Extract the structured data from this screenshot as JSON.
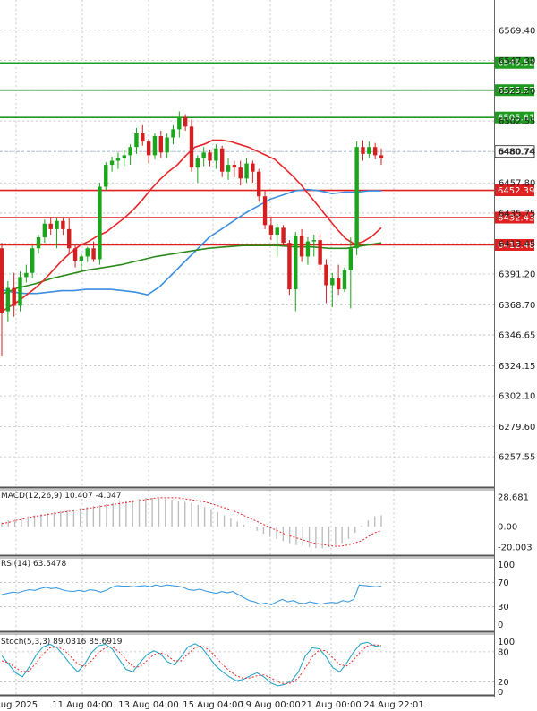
{
  "chart_data": {
    "type": "candlestick",
    "main": {
      "ylim": [
        6235.4,
        6591.5
      ],
      "y_ticks": [
        6569.4,
        6547.3,
        6525.2,
        6503.1,
        6480.74,
        6457.8,
        6435.75,
        6413.45,
        6391.2,
        6368.7,
        6346.65,
        6324.15,
        6302.1,
        6279.6,
        6257.55
      ],
      "y_tick_labels": [
        "6569.40",
        "6547.30",
        "6525.20",
        "6502.55",
        "6480.74",
        "6457.80",
        "6435.75",
        "6413.45",
        "6391.20",
        "6368.70",
        "6346.65",
        "6324.15",
        "6302.10",
        "6279.60",
        "6257.55"
      ],
      "current_price": 6480.74,
      "resistance_levels": [
        {
          "value": 6545.52,
          "label": "6545.52",
          "color": "#1e9a1e"
        },
        {
          "value": 6525.57,
          "label": "6525.57",
          "color": "#1e9a1e"
        },
        {
          "value": 6505.61,
          "label": "6505.61",
          "color": "#1e9a1e"
        }
      ],
      "support_levels": [
        {
          "value": 6452.39,
          "label": "6452.39",
          "color": "#e02020"
        },
        {
          "value": 6432.43,
          "label": "6432.43",
          "color": "#e02020"
        },
        {
          "value": 6412.48,
          "label": "6412.48",
          "color": "#e02020"
        }
      ],
      "candles": [
        [
          6410,
          6414,
          6331,
          6363
        ],
        [
          6364,
          6386,
          6356,
          6381
        ],
        [
          6381,
          6392,
          6360,
          6368
        ],
        [
          6368,
          6393,
          6364,
          6389
        ],
        [
          6389,
          6398,
          6385,
          6392
        ],
        [
          6392,
          6412,
          6388,
          6410
        ],
        [
          6410,
          6420,
          6406,
          6418
        ],
        [
          6418,
          6431,
          6414,
          6428
        ],
        [
          6428,
          6433,
          6420,
          6424
        ],
        [
          6424,
          6432,
          6410,
          6430
        ],
        [
          6430,
          6433,
          6420,
          6424
        ],
        [
          6424,
          6432,
          6406,
          6410
        ],
        [
          6410,
          6412,
          6396,
          6401
        ],
        [
          6401,
          6406,
          6394,
          6404
        ],
        [
          6404,
          6411,
          6400,
          6410
        ],
        [
          6410,
          6415,
          6400,
          6402
        ],
        [
          6402,
          6458,
          6398,
          6455
        ],
        [
          6455,
          6473,
          6452,
          6471
        ],
        [
          6471,
          6477,
          6466,
          6474
        ],
        [
          6474,
          6480,
          6468,
          6476
        ],
        [
          6476,
          6482,
          6470,
          6478
        ],
        [
          6478,
          6486,
          6471,
          6484
        ],
        [
          6484,
          6498,
          6479,
          6494
        ],
        [
          6494,
          6500,
          6485,
          6488
        ],
        [
          6488,
          6490,
          6472,
          6478
        ],
        [
          6478,
          6494,
          6475,
          6492
        ],
        [
          6492,
          6496,
          6476,
          6480
        ],
        [
          6480,
          6494,
          6476,
          6491
        ],
        [
          6491,
          6500,
          6486,
          6497
        ],
        [
          6497,
          6510,
          6491,
          6506
        ],
        [
          6506,
          6508,
          6496,
          6499
        ],
        [
          6499,
          6504,
          6466,
          6469
        ],
        [
          6469,
          6478,
          6458,
          6476
        ],
        [
          6476,
          6484,
          6470,
          6480
        ],
        [
          6480,
          6482,
          6470,
          6474
        ],
        [
          6474,
          6486,
          6468,
          6483
        ],
        [
          6483,
          6485,
          6462,
          6466
        ],
        [
          6466,
          6476,
          6460,
          6471
        ],
        [
          6471,
          6474,
          6462,
          6469
        ],
        [
          6469,
          6474,
          6456,
          6461
        ],
        [
          6461,
          6476,
          6458,
          6472
        ],
        [
          6472,
          6474,
          6458,
          6466
        ],
        [
          6466,
          6468,
          6444,
          6448
        ],
        [
          6448,
          6452,
          6424,
          6427
        ],
        [
          6427,
          6433,
          6416,
          6420
        ],
        [
          6420,
          6428,
          6404,
          6425
        ],
        [
          6425,
          6427,
          6412,
          6414
        ],
        [
          6414,
          6416,
          6376,
          6380
        ],
        [
          6380,
          6422,
          6364,
          6419
        ],
        [
          6419,
          6424,
          6400,
          6404
        ],
        [
          6404,
          6418,
          6398,
          6415
        ],
        [
          6415,
          6420,
          6404,
          6416
        ],
        [
          6416,
          6421,
          6394,
          6398
        ],
        [
          6398,
          6402,
          6370,
          6383
        ],
        [
          6383,
          6392,
          6367,
          6388
        ],
        [
          6388,
          6398,
          6376,
          6380
        ],
        [
          6380,
          6396,
          6378,
          6394
        ],
        [
          6394,
          6418,
          6366,
          6410
        ],
        [
          6410,
          6488,
          6405,
          6484
        ],
        [
          6484,
          6489,
          6474,
          6479
        ],
        [
          6479,
          6488,
          6476,
          6484
        ],
        [
          6484,
          6487,
          6475,
          6478
        ],
        [
          6478,
          6483,
          6471,
          6476
        ]
      ],
      "ma_red": [
        6363,
        6367,
        6371,
        6376,
        6381,
        6387,
        6394,
        6401,
        6407,
        6412,
        6415,
        6419,
        6422,
        6427,
        6432,
        6438,
        6445,
        6453,
        6460,
        6466,
        6471,
        6478,
        6484,
        6486,
        6489,
        6489,
        6488,
        6486,
        6484,
        6481,
        6478,
        6475,
        6469,
        6463,
        6456,
        6448,
        6440,
        6432,
        6424,
        6417,
        6413,
        6415,
        6419,
        6425
      ],
      "ma_blue": [
        6380,
        6378,
        6377,
        6377,
        6378,
        6379,
        6379,
        6380,
        6380,
        6380,
        6379,
        6378,
        6376,
        6382,
        6391,
        6400,
        6409,
        6418,
        6424,
        6430,
        6436,
        6441,
        6446,
        6449,
        6452,
        6453,
        6452,
        6450,
        6451,
        6451,
        6452,
        6452
      ],
      "ma_green": [
        6376,
        6381,
        6384,
        6388,
        6391,
        6394,
        6396,
        6398,
        6401,
        6404,
        6406,
        6408,
        6410,
        6411,
        6412,
        6412,
        6412,
        6411,
        6411,
        6410,
        6410,
        6412,
        6414
      ]
    },
    "x_tick_labels": [
      "Aug 2025",
      "11 Aug 04:00",
      "13 Aug 04:00",
      "15 Aug 04:00",
      "19 Aug 00:00",
      "21 Aug 00:00",
      "24 Aug 22:01"
    ],
    "macd": {
      "label": "MACD(12,26,9) 10.407 -4.047",
      "ylim": [
        -26,
        34
      ],
      "ticks": [
        28.681,
        0.0,
        -20.003
      ],
      "tick_labels": [
        "28.681",
        "0.00",
        "-20.003"
      ],
      "histogram": [
        4,
        6,
        7,
        9,
        10,
        11,
        12,
        13,
        14,
        15,
        16,
        17,
        18,
        19,
        20,
        21,
        22,
        23,
        24,
        25,
        26,
        27,
        28,
        28,
        28,
        27,
        26,
        25,
        24,
        23,
        21,
        19,
        17,
        14,
        11,
        8,
        5,
        2,
        -1,
        -4,
        -7,
        -10,
        -12,
        -14,
        -16,
        -18,
        -19,
        -20,
        -21,
        -21,
        -20,
        -18,
        -16,
        -12,
        -6,
        1,
        6,
        10,
        11
      ],
      "signal": [
        3,
        4,
        6,
        7,
        9,
        10,
        11,
        12,
        13,
        14,
        15,
        16,
        17,
        18,
        19,
        20,
        21,
        22,
        23,
        24,
        25,
        26,
        27,
        28,
        28,
        28,
        28,
        27,
        26,
        25,
        24,
        22,
        20,
        18,
        16,
        13,
        10,
        7,
        4,
        1,
        -2,
        -5,
        -8,
        -10,
        -12,
        -14,
        -16,
        -17,
        -18,
        -19,
        -19,
        -18,
        -16,
        -14,
        -10,
        -6,
        -4
      ]
    },
    "rsi": {
      "label": "RSI(14) 63.5478",
      "ylim": [
        -8,
        108
      ],
      "ticks": [
        100,
        70,
        30,
        0
      ],
      "tick_labels": [
        "100",
        "70",
        "30",
        "0"
      ],
      "guide_levels": [
        70,
        30
      ],
      "values": [
        50,
        52,
        54,
        53,
        56,
        58,
        57,
        60,
        62,
        60,
        61,
        58,
        56,
        55,
        57,
        55,
        58,
        57,
        54,
        57,
        62,
        65,
        64,
        64,
        63,
        64,
        65,
        63,
        66,
        64,
        66,
        65,
        64,
        62,
        58,
        57,
        59,
        56,
        54,
        52,
        55,
        53,
        55,
        50,
        45,
        40,
        38,
        34,
        36,
        33,
        38,
        42,
        38,
        40,
        36,
        35,
        38,
        36,
        34,
        36,
        37,
        36,
        40,
        38,
        42,
        66,
        65,
        64,
        63,
        64
      ]
    },
    "stoch": {
      "label": "Stoch(5,3,3) 89.0316 85.6919",
      "ylim": [
        -6,
        112
      ],
      "ticks": [
        100,
        80,
        20,
        0
      ],
      "tick_labels": [
        "100",
        "80",
        "20",
        "0"
      ],
      "guide_levels": [
        80,
        20
      ],
      "k": [
        72,
        55,
        38,
        30,
        50,
        74,
        90,
        95,
        88,
        72,
        54,
        40,
        55,
        78,
        92,
        95,
        86,
        65,
        45,
        40,
        58,
        74,
        82,
        76,
        60,
        54,
        70,
        90,
        96,
        88,
        70,
        52,
        40,
        30,
        22,
        25,
        32,
        38,
        30,
        18,
        12,
        15,
        22,
        40,
        72,
        88,
        86,
        70,
        48,
        40,
        58,
        80,
        96,
        99,
        92,
        90
      ],
      "d": [
        62,
        58,
        48,
        40,
        42,
        58,
        76,
        88,
        90,
        84,
        70,
        56,
        50,
        62,
        78,
        88,
        90,
        80,
        64,
        50,
        50,
        62,
        74,
        78,
        72,
        62,
        62,
        76,
        88,
        92,
        84,
        70,
        54,
        42,
        32,
        27,
        28,
        32,
        34,
        28,
        20,
        16,
        18,
        28,
        48,
        70,
        84,
        82,
        68,
        54,
        52,
        64,
        80,
        92,
        94,
        93
      ]
    }
  }
}
